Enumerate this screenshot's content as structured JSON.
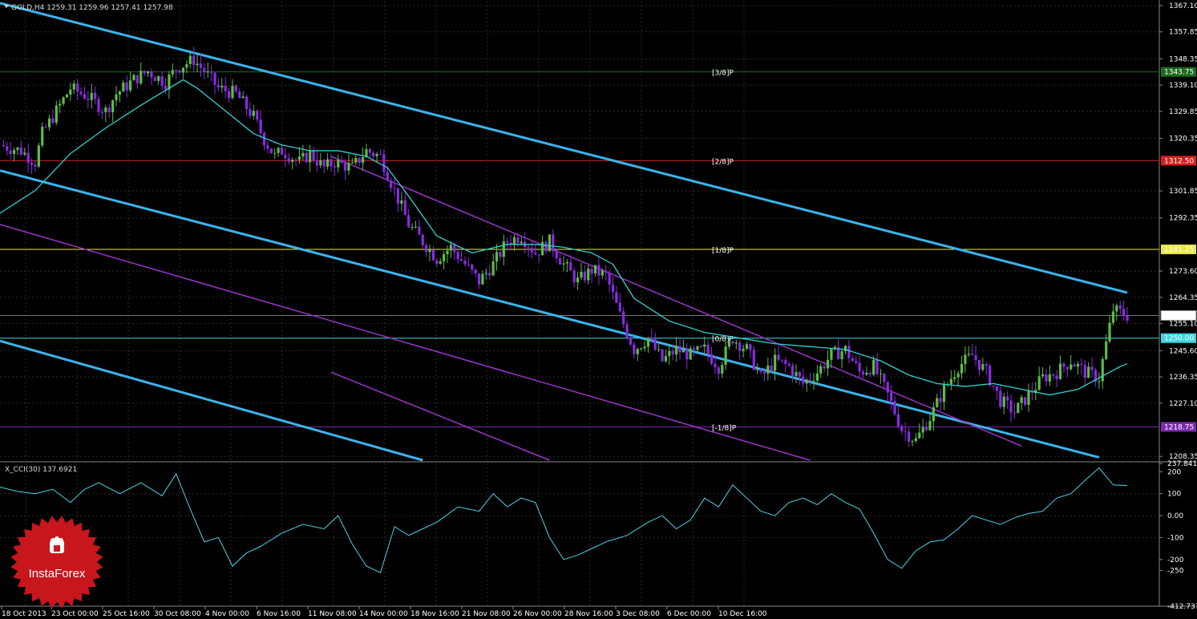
{
  "header": {
    "symbol_line": "GOLD,H4  1259.31 1259.96 1257.41 1257.98",
    "indicator_line": "X_CCI(30) 137.6921"
  },
  "watermark": {
    "brand": "InstaForex",
    "icon": "insta-crown-icon"
  },
  "colors": {
    "background": "#000000",
    "grid": "#2c2c2c",
    "bull": "#5cbd45",
    "bear": "#8a2be2",
    "doji": "#35c6e0",
    "ma": "#33d0d0",
    "cci": "#4fd3e6",
    "channel_blue": "#3ab4ec",
    "channel_purple": "#9a35c9",
    "level_green": "#1c6b1c",
    "level_red": "#d42020",
    "level_yellow": "#e8e84a",
    "level_cyan": "#3cd6e0",
    "level_purple": "#7b2bb0"
  },
  "chart_data": [
    {
      "type": "candlestick",
      "title": "GOLD,H4",
      "x_ticks": [
        "18 Oct 2013",
        "23 Oct 00:00",
        "25 Oct 16:00",
        "30 Oct 08:00",
        "4 Nov 00:00",
        "6 Nov 16:00",
        "11 Nov 08:00",
        "14 Nov 00:00",
        "18 Nov 16:00",
        "21 Nov 08:00",
        "26 Nov 00:00",
        "28 Nov 16:00",
        "3 Dec 08:00",
        "6 Dec 00:00",
        "10 Dec 16:00"
      ],
      "y_ticks": [
        1367.1,
        1357.85,
        1348.35,
        1339.1,
        1329.85,
        1320.35,
        1301.85,
        1292.35,
        1273.6,
        1264.35,
        1255.1,
        1245.6,
        1236.35,
        1227.1,
        1208.35
      ],
      "ylim": [
        1207.0,
        1368.5
      ],
      "current_price": 1257.98,
      "price_labels": [
        {
          "price": 1281.25,
          "text": "1281.25",
          "color": "#e8e84a"
        },
        {
          "price": 1257.98,
          "text": "1257.98",
          "color": "#000000"
        },
        {
          "price": 1250.0,
          "text": "1250.00",
          "color": "#3cd6e0"
        },
        {
          "price": 1343.75,
          "text": "1343.75",
          "color": "#1c6b1c"
        },
        {
          "price": 1312.5,
          "text": "1312.50",
          "color": "#d42020"
        },
        {
          "price": 1218.75,
          "text": "1218.75",
          "color": "#7b2bb0"
        }
      ],
      "murrey_levels": [
        {
          "price": 1343.75,
          "label": "[3/8]P",
          "color": "#1c6b1c"
        },
        {
          "price": 1312.5,
          "label": "[2/8]P",
          "color": "#d42020"
        },
        {
          "price": 1281.25,
          "label": "[1/8]P",
          "color": "#e8e84a"
        },
        {
          "price": 1250.0,
          "label": "[0/8]P",
          "color": "#3cd6e0"
        },
        {
          "price": 1218.75,
          "label": "[-1/8]P",
          "color": "#7b2bb0"
        }
      ],
      "close_path": [
        [
          0,
          1318
        ],
        [
          6,
          1316
        ],
        [
          10,
          1312
        ],
        [
          12,
          1322
        ],
        [
          14,
          1326
        ],
        [
          20,
          1338
        ],
        [
          25,
          1335
        ],
        [
          30,
          1330
        ],
        [
          33,
          1336
        ],
        [
          38,
          1341
        ],
        [
          42,
          1344
        ],
        [
          47,
          1340
        ],
        [
          50,
          1345
        ],
        [
          55,
          1348
        ],
        [
          58,
          1344
        ],
        [
          62,
          1338
        ],
        [
          67,
          1336
        ],
        [
          72,
          1328
        ],
        [
          75,
          1320
        ],
        [
          78,
          1314
        ],
        [
          80,
          1316
        ],
        [
          85,
          1312
        ],
        [
          88,
          1315
        ],
        [
          92,
          1310
        ],
        [
          95,
          1312
        ],
        [
          100,
          1310
        ],
        [
          104,
          1316
        ],
        [
          108,
          1314
        ],
        [
          112,
          1302
        ],
        [
          116,
          1290
        ],
        [
          120,
          1284
        ],
        [
          124,
          1278
        ],
        [
          128,
          1282
        ],
        [
          132,
          1276
        ],
        [
          136,
          1270
        ],
        [
          140,
          1276
        ],
        [
          144,
          1284
        ],
        [
          148,
          1286
        ],
        [
          152,
          1280
        ],
        [
          156,
          1284
        ],
        [
          160,
          1276
        ],
        [
          164,
          1270
        ],
        [
          168,
          1274
        ],
        [
          172,
          1272
        ],
        [
          176,
          1258
        ],
        [
          180,
          1246
        ],
        [
          184,
          1250
        ],
        [
          188,
          1242
        ],
        [
          192,
          1246
        ],
        [
          196,
          1244
        ],
        [
          200,
          1246
        ],
        [
          204,
          1240
        ],
        [
          208,
          1250
        ],
        [
          212,
          1246
        ],
        [
          216,
          1236
        ],
        [
          220,
          1242
        ],
        [
          224,
          1240
        ],
        [
          228,
          1234
        ],
        [
          232,
          1238
        ],
        [
          236,
          1244
        ],
        [
          240,
          1246
        ],
        [
          244,
          1238
        ],
        [
          248,
          1240
        ],
        [
          252,
          1230
        ],
        [
          256,
          1218
        ],
        [
          260,
          1214
        ],
        [
          264,
          1222
        ],
        [
          268,
          1232
        ],
        [
          272,
          1240
        ],
        [
          276,
          1244
        ],
        [
          280,
          1238
        ],
        [
          284,
          1228
        ],
        [
          288,
          1224
        ],
        [
          292,
          1230
        ],
        [
          296,
          1236
        ],
        [
          300,
          1238
        ],
        [
          304,
          1242
        ],
        [
          308,
          1238
        ],
        [
          312,
          1236
        ],
        [
          316,
          1260
        ],
        [
          320,
          1258
        ]
      ],
      "ma_path": [
        [
          0,
          1294
        ],
        [
          10,
          1302
        ],
        [
          20,
          1315
        ],
        [
          30,
          1324
        ],
        [
          40,
          1332
        ],
        [
          48,
          1338
        ],
        [
          52,
          1341
        ],
        [
          56,
          1338
        ],
        [
          64,
          1330
        ],
        [
          72,
          1322
        ],
        [
          80,
          1318
        ],
        [
          88,
          1316
        ],
        [
          96,
          1316
        ],
        [
          104,
          1314
        ],
        [
          110,
          1310
        ],
        [
          116,
          1300
        ],
        [
          124,
          1286
        ],
        [
          134,
          1280
        ],
        [
          144,
          1283
        ],
        [
          152,
          1283
        ],
        [
          160,
          1282
        ],
        [
          168,
          1280
        ],
        [
          174,
          1276
        ],
        [
          180,
          1264
        ],
        [
          190,
          1256
        ],
        [
          200,
          1252
        ],
        [
          210,
          1250
        ],
        [
          220,
          1248
        ],
        [
          230,
          1247
        ],
        [
          240,
          1246
        ],
        [
          250,
          1242
        ],
        [
          258,
          1237
        ],
        [
          266,
          1234
        ],
        [
          274,
          1233
        ],
        [
          282,
          1234
        ],
        [
          290,
          1232
        ],
        [
          298,
          1230
        ],
        [
          306,
          1232
        ],
        [
          312,
          1236
        ],
        [
          318,
          1240
        ],
        [
          320,
          1241
        ]
      ],
      "channels": [
        {
          "color": "#3ab4ec",
          "from": [
            0,
            1368
          ],
          "to": [
            320,
            1266
          ]
        },
        {
          "color": "#3ab4ec",
          "from": [
            0,
            1309
          ],
          "to": [
            312,
            1208
          ]
        },
        {
          "color": "#3ab4ec",
          "from": [
            0,
            1249
          ],
          "to": [
            120,
            1207
          ]
        },
        {
          "color": "#9a35c9",
          "from": [
            94,
            1314
          ],
          "to": [
            290,
            1212
          ]
        },
        {
          "color": "#9a35c9",
          "from": [
            0,
            1290
          ],
          "to": [
            230,
            1207
          ]
        },
        {
          "color": "#9a35c9",
          "from": [
            94,
            1238
          ],
          "to": [
            156,
            1207
          ]
        }
      ]
    },
    {
      "type": "line",
      "title": "X_CCI(30)",
      "series_name": "X_CCI(30)",
      "y_ticks": [
        237.8411,
        200,
        100,
        0.0,
        -100,
        -200,
        -250,
        -412.7374
      ],
      "y_tick_labels": [
        "237.8411",
        "200",
        "100",
        "0.00",
        "-100",
        "-200",
        "-250",
        "-412.7374"
      ],
      "ylim": [
        -412.7374,
        237.8411
      ],
      "current_value": 137.6921,
      "values": [
        [
          0,
          130
        ],
        [
          5,
          110
        ],
        [
          10,
          100
        ],
        [
          15,
          120
        ],
        [
          20,
          60
        ],
        [
          24,
          120
        ],
        [
          28,
          150
        ],
        [
          34,
          100
        ],
        [
          40,
          150
        ],
        [
          46,
          90
        ],
        [
          50,
          190
        ],
        [
          54,
          30
        ],
        [
          58,
          -120
        ],
        [
          62,
          -100
        ],
        [
          66,
          -230
        ],
        [
          70,
          -170
        ],
        [
          74,
          -140
        ],
        [
          80,
          -80
        ],
        [
          86,
          -40
        ],
        [
          92,
          -60
        ],
        [
          96,
          0
        ],
        [
          100,
          -130
        ],
        [
          104,
          -230
        ],
        [
          108,
          -260
        ],
        [
          112,
          -50
        ],
        [
          116,
          -90
        ],
        [
          120,
          -60
        ],
        [
          124,
          -30
        ],
        [
          130,
          40
        ],
        [
          136,
          20
        ],
        [
          140,
          100
        ],
        [
          144,
          40
        ],
        [
          148,
          80
        ],
        [
          152,
          60
        ],
        [
          156,
          -100
        ],
        [
          160,
          -200
        ],
        [
          164,
          -180
        ],
        [
          168,
          -150
        ],
        [
          172,
          -120
        ],
        [
          178,
          -90
        ],
        [
          184,
          -30
        ],
        [
          188,
          0
        ],
        [
          192,
          -60
        ],
        [
          196,
          -20
        ],
        [
          200,
          80
        ],
        [
          204,
          40
        ],
        [
          208,
          140
        ],
        [
          212,
          80
        ],
        [
          216,
          20
        ],
        [
          220,
          0
        ],
        [
          224,
          60
        ],
        [
          228,
          80
        ],
        [
          232,
          50
        ],
        [
          236,
          100
        ],
        [
          240,
          60
        ],
        [
          244,
          30
        ],
        [
          248,
          -80
        ],
        [
          252,
          -200
        ],
        [
          256,
          -240
        ],
        [
          260,
          -160
        ],
        [
          264,
          -120
        ],
        [
          268,
          -110
        ],
        [
          272,
          -60
        ],
        [
          276,
          0
        ],
        [
          280,
          -20
        ],
        [
          284,
          -40
        ],
        [
          288,
          -10
        ],
        [
          292,
          10
        ],
        [
          296,
          20
        ],
        [
          300,
          80
        ],
        [
          304,
          100
        ],
        [
          308,
          160
        ],
        [
          312,
          218
        ],
        [
          316,
          140
        ],
        [
          320,
          137
        ]
      ]
    }
  ]
}
